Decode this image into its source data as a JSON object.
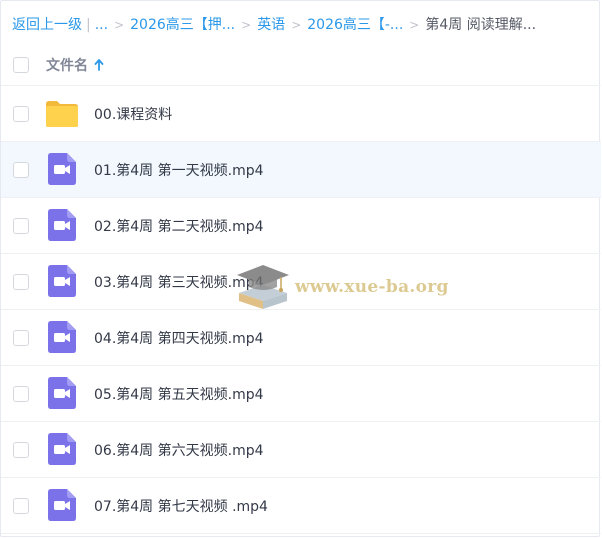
{
  "breadcrumb": {
    "back_label": "返回上一级",
    "separator_bar": "|",
    "ellipsis": "...",
    "sep": ">",
    "crumbs": [
      "2026高三【押...",
      "英语",
      "2026高三【-..."
    ],
    "current": "第4周 阅读理解..."
  },
  "header": {
    "column_name": "文件名",
    "sort": "ascending"
  },
  "files": [
    {
      "name": "00.课程资料",
      "type": "folder",
      "icon": "folder-icon"
    },
    {
      "name": "01.第4周 第一天视频.mp4",
      "type": "video",
      "icon": "video-file-icon"
    },
    {
      "name": "02.第4周 第二天视频.mp4",
      "type": "video",
      "icon": "video-file-icon"
    },
    {
      "name": "03.第4周 第三天视频.mp4",
      "type": "video",
      "icon": "video-file-icon"
    },
    {
      "name": "04.第4周 第四天视频.mp4",
      "type": "video",
      "icon": "video-file-icon"
    },
    {
      "name": "05.第4周 第五天视频.mp4",
      "type": "video",
      "icon": "video-file-icon"
    },
    {
      "name": "06.第4周 第六天视频.mp4",
      "type": "video",
      "icon": "video-file-icon"
    },
    {
      "name": "07.第4周 第七天视频 .mp4",
      "type": "video",
      "icon": "video-file-icon"
    }
  ],
  "watermark": {
    "text": "www.xue-ba.org"
  },
  "colors": {
    "link": "#2b98e9",
    "folder": "#ffd24d",
    "video": "#7b72ea",
    "hover_row": "#f2f8fe"
  }
}
